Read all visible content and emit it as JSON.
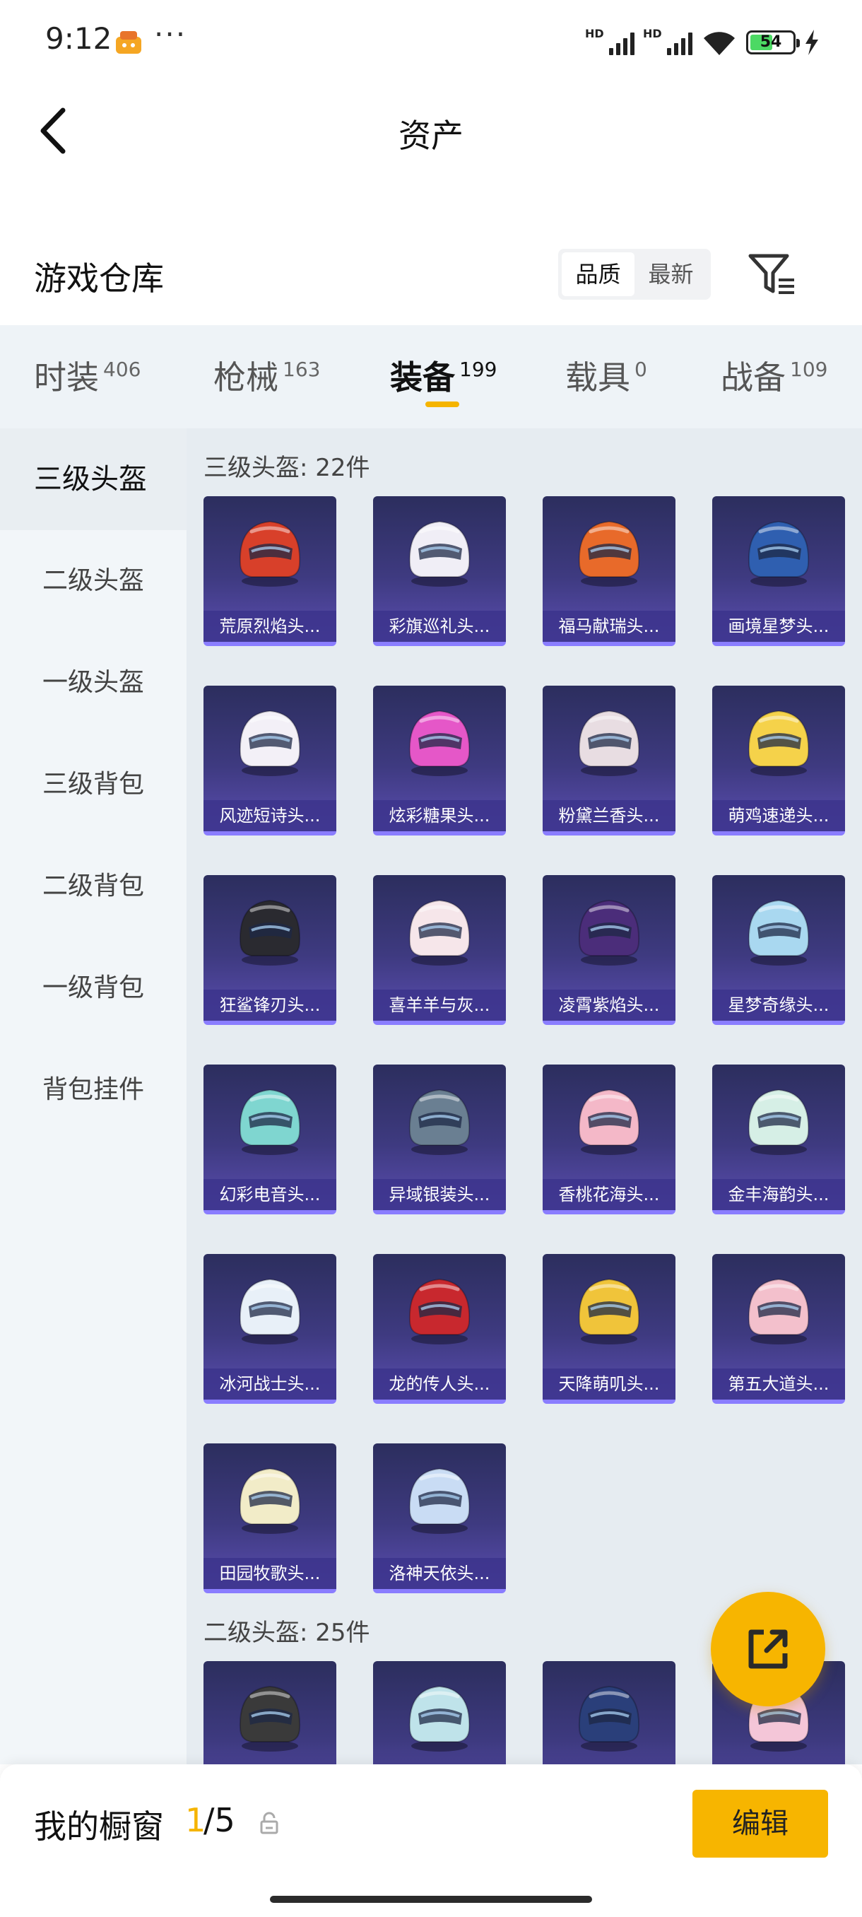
{
  "status": {
    "time": "9:12",
    "dots": "···",
    "battery": "54"
  },
  "header": {
    "title": "资产"
  },
  "warehouse": {
    "title": "游戏仓库",
    "sort": [
      "品质",
      "最新"
    ]
  },
  "tabs": [
    {
      "name": "时装",
      "count": "406"
    },
    {
      "name": "枪械",
      "count": "163"
    },
    {
      "name": "装备",
      "count": "199"
    },
    {
      "name": "载具",
      "count": "0"
    },
    {
      "name": "战备",
      "count": "109"
    }
  ],
  "side": [
    "三级头盔",
    "二级头盔",
    "一级头盔",
    "三级背包",
    "二级背包",
    "一级背包",
    "背包挂件"
  ],
  "sections": [
    {
      "title": "三级头盔: 22件",
      "items": [
        {
          "name": "荒原烈焰头...",
          "color": "#d8402a"
        },
        {
          "name": "彩旗巡礼头...",
          "color": "#f0eef6"
        },
        {
          "name": "福马献瑞头...",
          "color": "#e86a2a"
        },
        {
          "name": "画境星梦头...",
          "color": "#2f5fb0"
        },
        {
          "name": "风迹短诗头...",
          "color": "#f3f0f7"
        },
        {
          "name": "炫彩糖果头...",
          "color": "#e557c8"
        },
        {
          "name": "粉黛兰香头...",
          "color": "#e8dde2"
        },
        {
          "name": "萌鸡速递头...",
          "color": "#f5d24a"
        },
        {
          "name": "狂鲨锋刃头...",
          "color": "#2a2a30"
        },
        {
          "name": "喜羊羊与灰...",
          "color": "#f6e6ea"
        },
        {
          "name": "凌霄紫焰头...",
          "color": "#4b2d7a"
        },
        {
          "name": "星梦奇缘头...",
          "color": "#a9d8f0"
        },
        {
          "name": "幻彩电音头...",
          "color": "#7fd6d0"
        },
        {
          "name": "异域银装头...",
          "color": "#6a7f92"
        },
        {
          "name": "香桃花海头...",
          "color": "#f4b8c8"
        },
        {
          "name": "金丰海韵头...",
          "color": "#d6efe6"
        },
        {
          "name": "冰河战士头...",
          "color": "#e8f0f8"
        },
        {
          "name": "龙的传人头...",
          "color": "#c8282e"
        },
        {
          "name": "天降萌叽头...",
          "color": "#f0c43a"
        },
        {
          "name": "第五大道头...",
          "color": "#f3c0cc"
        },
        {
          "name": "田园牧歌头...",
          "color": "#f2ecc8"
        },
        {
          "name": "洛神天依头...",
          "color": "#c9dcf4"
        }
      ]
    },
    {
      "title": "二级头盔: 25件",
      "items": [
        {
          "name": "",
          "color": "#3a3a3a"
        },
        {
          "name": "",
          "color": "#bfe3ea"
        },
        {
          "name": "",
          "color": "#2a3f7a"
        },
        {
          "name": "",
          "color": "#f4c6d8"
        }
      ]
    }
  ],
  "showcase": {
    "title": "我的橱窗",
    "current": "1",
    "total": "/5",
    "edit": "编辑"
  }
}
